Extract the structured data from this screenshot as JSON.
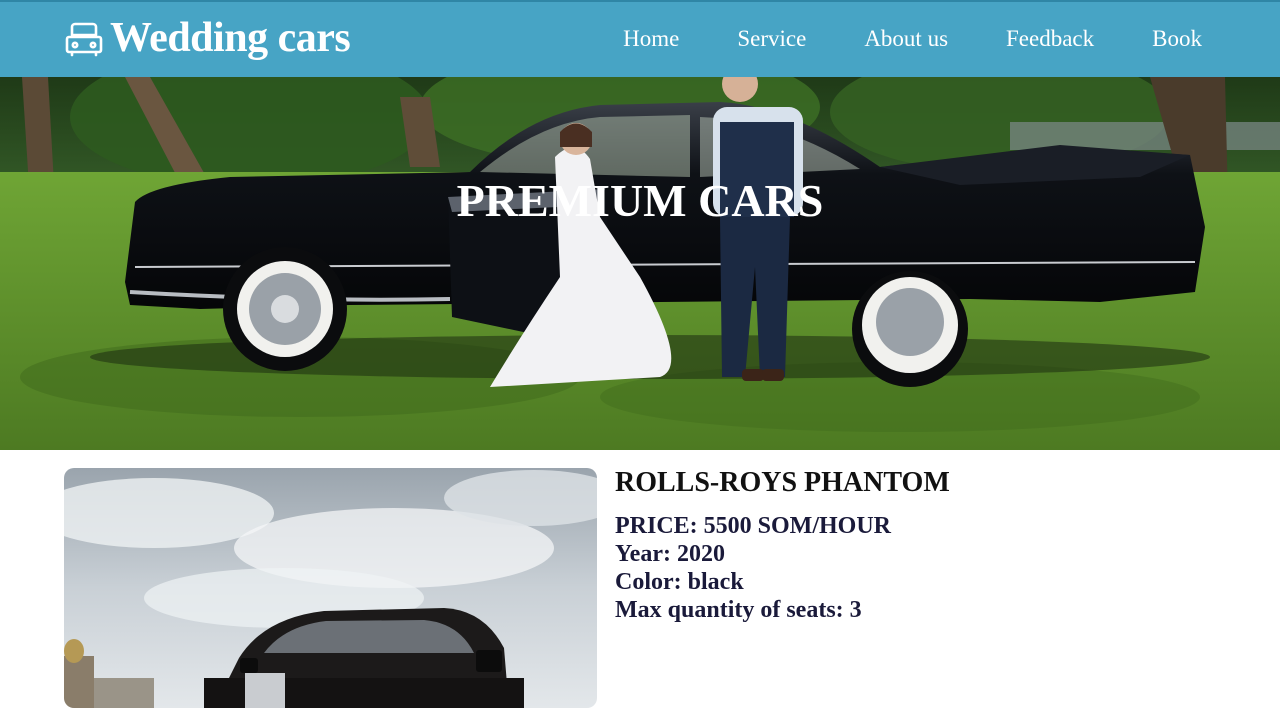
{
  "brand": {
    "name": "Wedding cars",
    "icon": "car-icon"
  },
  "nav": {
    "items": [
      {
        "label": "Home"
      },
      {
        "label": "Service"
      },
      {
        "label": "About us"
      },
      {
        "label": "Feedback"
      },
      {
        "label": "Book"
      }
    ]
  },
  "hero": {
    "title": "PREMIUM CARS"
  },
  "car": {
    "name": "ROLLS-ROYS PHANTOM",
    "price": "PRICE: 5500 SOM/HOUR",
    "year": "Year: 2020",
    "color": "Color: black",
    "seats": "Max quantity of seats: 3"
  },
  "colors": {
    "navbar": "#47a4c5",
    "text_dark": "#111111",
    "spec_text": "#1a1a3a"
  }
}
